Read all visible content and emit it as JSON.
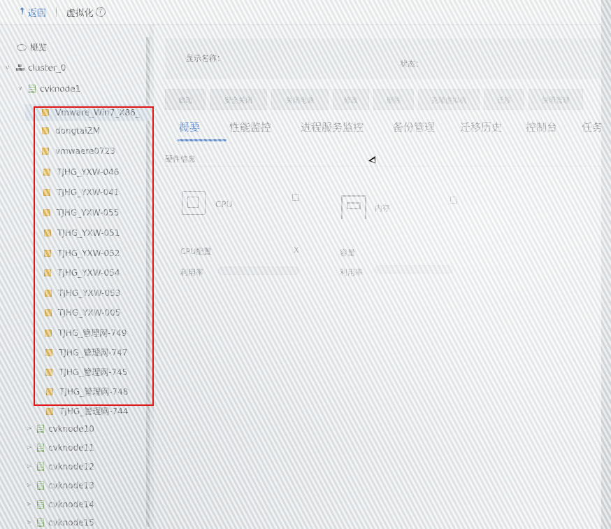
{
  "topbar": {
    "back_label": "返回",
    "section_label": "虚拟化"
  },
  "tree": {
    "overview": "概览",
    "cluster": "cluster_0",
    "host": "cvknode1",
    "vms": [
      "Vmware_Win7_X86_",
      "dongtaiZM",
      "vmwaere0723",
      "TJHG_YXW-046",
      "TJHG_YXW-041",
      "TJHG_YXW-055",
      "TJHG_YXW-051",
      "TJHG_YXW-052",
      "TJHG_YXW-054",
      "TJHG_YXW-053",
      "TJHG_YXW-005",
      "TJHG_管理网-749",
      "TJHG_管理网-747",
      "TJHG_管理网-745",
      "TJHG_管理网-748",
      "TJHG_管理网-744"
    ],
    "other_hosts": [
      "cvknode10",
      "cvknode11",
      "cvknode12",
      "cvknode13",
      "cvknode14",
      "cvknode15"
    ]
  },
  "main": {
    "display_name_label": "显示名称：",
    "status_label": "状态：",
    "buttons": [
      "启动",
      "安全关闭",
      "关闭电源",
      "修改",
      "删除",
      "克隆虚拟机",
      "迁移",
      "快照管理"
    ],
    "tabs": [
      "概要",
      "性能监控",
      "进程服务监控",
      "备份管理",
      "迁移历史",
      "控制台",
      "任务"
    ],
    "section_title": "硬件信息",
    "cpu": {
      "title": "CPU",
      "config_label": "CPU配置",
      "config_value": "X",
      "usage_label": "利用率"
    },
    "memory": {
      "title": "内存",
      "capacity_label": "容量",
      "usage_label": "利用率"
    }
  }
}
